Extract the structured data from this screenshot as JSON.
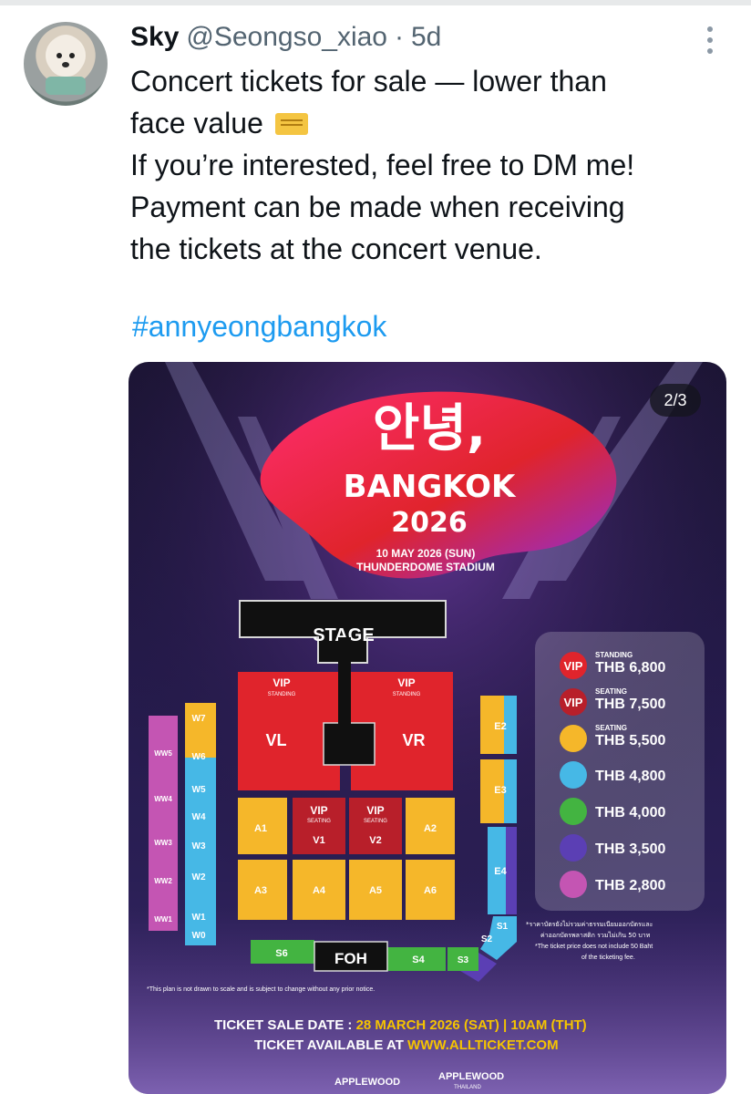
{
  "tweet": {
    "author_name": "Sky",
    "handle": "@Seongso_xiao",
    "separator": "·",
    "time": "5d",
    "lines": [
      "Concert tickets for sale — lower than",
      "face value",
      "If you’re interested, feel free to DM me!",
      "Payment can be made when receiving",
      "the tickets at the concert venue."
    ],
    "hashtag": "#annyeongbangkok",
    "media_counter": "2/3"
  },
  "poster": {
    "title_korean": "안녕,",
    "title_city": "BANGKOK",
    "title_year": "2026",
    "date": "10 MAY 2026 (SUN)",
    "venue": "THUNDERDOME STADIUM",
    "stage": "STAGE",
    "foh": "FOH",
    "zones": {
      "vip": "VIP",
      "standing": "STANDING",
      "seating": "SEATING",
      "vl": "VL",
      "vr": "VR",
      "v1": "V1",
      "v2": "V2",
      "a1": "A1",
      "a2": "A2",
      "a3": "A3",
      "a4": "A4",
      "a5": "A5",
      "a6": "A6",
      "e2": "E2",
      "e3": "E3",
      "e4": "E4",
      "s1": "S1",
      "s2": "S2",
      "s3": "S3",
      "s4": "S4",
      "s6": "S6",
      "w7": "W7",
      "w6": "W6",
      "w5": "W5",
      "w4": "W4",
      "w3": "W3",
      "w2": "W2",
      "w1": "W1",
      "w0": "W0",
      "ww5": "WW5",
      "ww4": "WW4",
      "ww3": "WW3",
      "ww2": "WW2",
      "ww1": "WW1"
    },
    "prices": [
      {
        "tag": "VIP",
        "sub": "STANDING",
        "price": "THB 6,800",
        "color": "#e0242c"
      },
      {
        "tag": "VIP",
        "sub": "SEATING",
        "price": "THB 7,500",
        "color": "#b81f2a"
      },
      {
        "tag": "",
        "sub": "SEATING",
        "price": "THB 5,500",
        "color": "#f5b72a"
      },
      {
        "tag": "",
        "sub": "",
        "price": "THB 4,800",
        "color": "#46b8e6"
      },
      {
        "tag": "",
        "sub": "",
        "price": "THB 4,000",
        "color": "#43b441"
      },
      {
        "tag": "",
        "sub": "",
        "price": "THB 3,500",
        "color": "#5b3fb4"
      },
      {
        "tag": "",
        "sub": "",
        "price": "THB 2,800",
        "color": "#c455b3"
      }
    ],
    "thai_note_1": "*ราคาบัตรยังไม่รวมค่าธรรมเนียมออกบัตรและ",
    "thai_note_2": "ค่าออกบัตรพลาสติก รวมไม่เกิน 50 บาท",
    "fee_note_1": "*The ticket price does not include 50 Baht",
    "fee_note_2": "of the ticketing fee.",
    "disclaimer": "*This plan is not drawn to scale and is subject to change without any prior notice.",
    "sale_label": "TICKET SALE DATE : ",
    "sale_value": "28 MARCH 2026 (SAT) | 10AM (THT)",
    "available_label": "TICKET AVAILABLE AT ",
    "available_value": "WWW.ALLTICKET.COM",
    "logo1": "APPLEWOOD",
    "logo2": "APPLEWOOD",
    "logo2_sub": "THAILAND"
  },
  "colors": {
    "vip_red": "#e0242c",
    "vip_seat_red": "#b81f2a",
    "yellow": "#f5b72a",
    "blue": "#46b8e6",
    "green": "#43b441",
    "purple": "#5b3fb4",
    "pink": "#c455b3",
    "link": "#1d9bf0",
    "accent_yellow": "#f5c400"
  }
}
